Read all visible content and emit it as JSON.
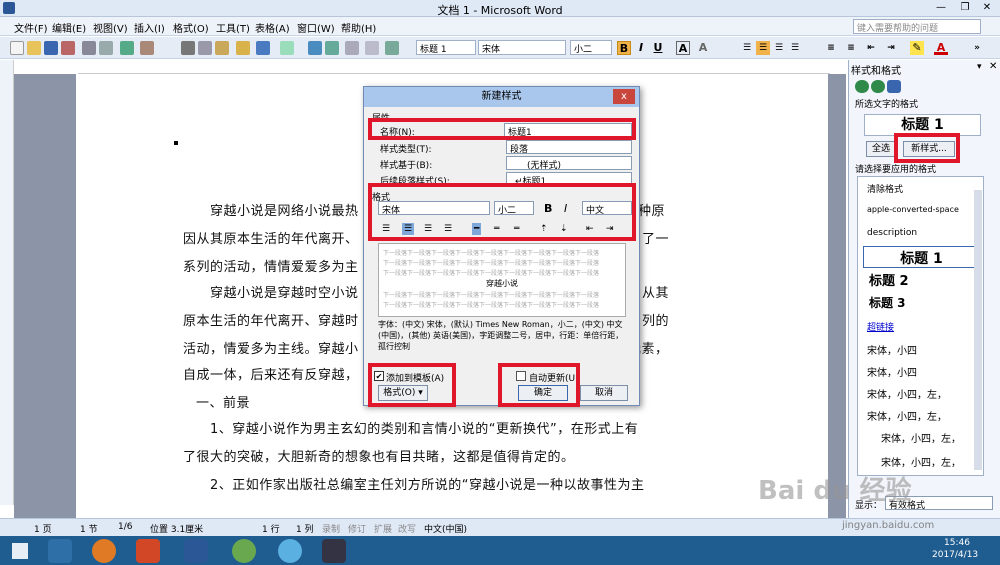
{
  "window": {
    "title": "文档 1 - Microsoft Word",
    "help_placeholder": "键入需要帮助的问题"
  },
  "menu": [
    "文件(F)",
    "编辑(E)",
    "视图(V)",
    "插入(I)",
    "格式(O)",
    "工具(T)",
    "表格(A)",
    "窗口(W)",
    "帮助(H)"
  ],
  "format_bar": {
    "style": "标题 1",
    "font": "宋体",
    "size": "小二",
    "bold": "B",
    "italic": "I",
    "underline": "U",
    "font_color_icon": "A"
  },
  "document": {
    "paragraphs": [
      "穿越小说是网络小说最热",
      "因从其原本生活的年代离开、",
      "系列的活动，情情爱爱多为主",
      "穿越小说是穿越时空小说",
      "原本生活的年代离开、穿越时",
      "活动，情爱多为主线。穿越小",
      "自成一体，后来还有反穿越，",
      "一、前景",
      "1、穿越小说作为男主玄幻的类别和言情小说的“更新换代”，在形式上有",
      "了很大的突破，大胆新奇的想象也有目共睹，这都是值得肯定的。",
      "2、正如作家出版社总编室主任刘方所说的“穿越小说是一种以故事性为主"
    ],
    "right_fragments": [
      "种原",
      "了一",
      "从其",
      "列的",
      "元素，"
    ]
  },
  "dialog": {
    "title": "新建样式",
    "close": "x",
    "section_properties": "属性",
    "name_label": "名称(N):",
    "name_value": "标题1",
    "type_label": "样式类型(T):",
    "type_value": "段落",
    "based_label": "样式基于(B):",
    "based_value": "(无样式)",
    "next_label": "后续段落样式(S):",
    "next_value": "↵标题1",
    "section_format": "格式",
    "font": "宋体",
    "size": "小二",
    "bold": "B",
    "italic": "I",
    "lang": "中文",
    "preview_title": "穿越小说",
    "preview_text": "下一段落下一段落下一段落下一段落下一段落下一段落下一段落下一段落下一段落",
    "description": "字体：(中文) 宋体，(默认) Times New Roman，小二，(中文) 中文(中国)，(其他) 英语(美国)，字距调整二号，居中，行距：单倍行距，孤行控制",
    "add_template": "添加到模板(A)",
    "auto_update": "自动更新(U)",
    "format_button": "格式(O) ▾",
    "ok": "确定",
    "cancel": "取消"
  },
  "pane": {
    "title": "样式和格式",
    "selected_label": "所选文字的格式",
    "selected_value": "标题 1",
    "select_all": "全选",
    "new_style": "新样式...",
    "apply_label": "请选择要应用的格式",
    "styles": [
      "清除格式",
      "apple-converted-space",
      "description",
      "标题 1",
      "标题 2",
      "标题 3",
      "超链接",
      "宋体，小四",
      "宋体，小四",
      "宋体，小四，左，",
      "宋体，小四，左，",
      "宋体，小四，左，",
      "宋体，小四，左，"
    ],
    "show_label": "显示：",
    "show_value": "有效格式"
  },
  "status": {
    "page": "1 页",
    "section": "1 节",
    "of": "1/6",
    "pos": "位置 3.1厘米",
    "line": "1 行",
    "col": "1 列",
    "rec": "录制",
    "trk": "修订",
    "ext": "扩展",
    "ovr": "改写",
    "lang": "中文(中国)"
  },
  "taskbar": {
    "time": "15:46",
    "date": "2017/4/13"
  },
  "watermark": {
    "brand": "Bai du 经验",
    "url": "jingyan.baidu.com"
  },
  "colors": {
    "highlight_red": "#e0162b",
    "titlebar": "#dfe8f5",
    "taskbar": "#1f5c8f"
  }
}
